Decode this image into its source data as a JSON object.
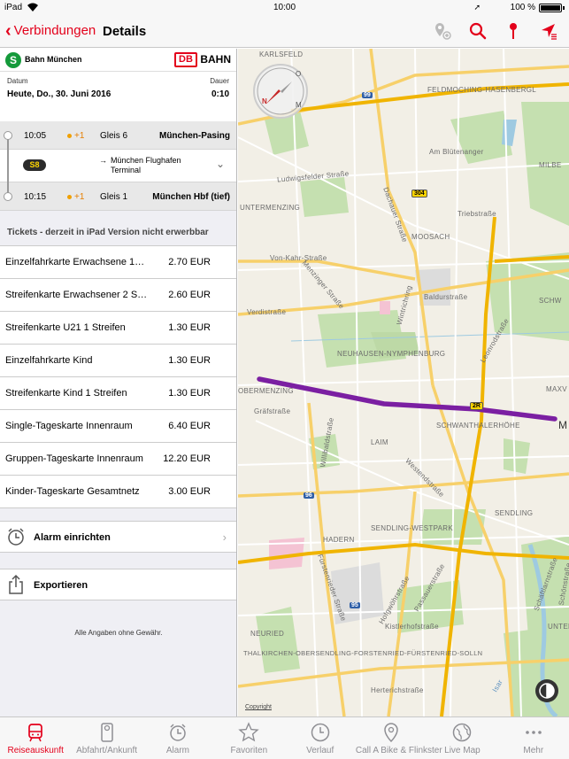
{
  "status_bar": {
    "device": "iPad",
    "time": "10:00",
    "battery": "100 %"
  },
  "nav": {
    "back_label": "Verbindungen",
    "title": "Details"
  },
  "header": {
    "operator": "Bahn München",
    "db_logo": "DB",
    "brand": "BAHN"
  },
  "date_row": {
    "date_label": "Datum",
    "date_value": "Heute, Do., 30. Juni 2016",
    "duration_label": "Dauer",
    "duration_value": "0:10"
  },
  "journey": {
    "departure": {
      "time": "10:05",
      "delay": "+1",
      "platform": "Gleis 6",
      "station": "München-Pasing"
    },
    "line": {
      "badge": "S8",
      "destination": "München Flughafen Terminal"
    },
    "arrival": {
      "time": "10:15",
      "delay": "+1",
      "platform": "Gleis 1",
      "station": "München Hbf (tief)"
    }
  },
  "tickets": {
    "heading": "Tickets - derzeit in iPad Version nicht erwerbbar",
    "items": [
      {
        "name": "Einzelfahrkarte Erwachsene 1…",
        "price": "2.70 EUR"
      },
      {
        "name": "Streifenkarte Erwachsener 2 S…",
        "price": "2.60 EUR"
      },
      {
        "name": "Streifenkarte U21 1 Streifen",
        "price": "1.30 EUR"
      },
      {
        "name": "Einzelfahrkarte Kind",
        "price": "1.30 EUR"
      },
      {
        "name": "Streifenkarte Kind 1 Streifen",
        "price": "1.30 EUR"
      },
      {
        "name": "Single-Tageskarte Innenraum",
        "price": "6.40 EUR"
      },
      {
        "name": "Gruppen-Tageskarte Innenraum",
        "price": "12.20 EUR"
      },
      {
        "name": "Kinder-Tageskarte Gesamtnetz",
        "price": "3.00 EUR"
      }
    ]
  },
  "actions": {
    "alarm": "Alarm einrichten",
    "export": "Exportieren"
  },
  "disclaimer": "Alle Angaben ohne Gewähr.",
  "map": {
    "labels": {
      "karlsfeld": "KARLSFELD",
      "feldmoching": "FELDMOCHING-HASENBERGL",
      "milbe": "MILBE",
      "am_blutenanger": "Am Blütenanger",
      "ludwigsfelder": "Ludwigsfelder Straße",
      "untermenzing": "UNTERMENZING",
      "dachauer": "Dachauer Straße",
      "triebstrasse": "Triebstraße",
      "moosach": "MOOSACH",
      "von_kahr": "Von-Kahr-Straße",
      "menzinger": "Menzinger Straße",
      "baldurstrasse": "Baldurstraße",
      "schw": "SCHW",
      "verdistrasse": "Verdistraße",
      "wintrichring": "Wintrichring",
      "leonrodstrasse": "Leonrodstraße",
      "neuhausen": "NEUHAUSEN-NYMPHENBURG",
      "obermenzing": "OBERMENZING",
      "maxv": "MAXV",
      "grafstrasse": "Gräfstraße",
      "schwanthaler": "SCHWANTHALERHÖHE",
      "willibald": "Willibaldstraße",
      "laim": "LAIM",
      "m": "M",
      "westend": "Westendstraße",
      "sendling": "SENDLING",
      "sendling_westpark": "SENDLING-WESTPARK",
      "hadern": "HADERN",
      "fuerstenrieder": "Fürstenrieder Straße",
      "passauer": "Passauerstraße",
      "hofgwoehr": "Hofgwöhrstraße",
      "kistlerhof": "Kistlerhofstraße",
      "neuried": "NEURIED",
      "untergiesing": "UNTERGIE",
      "thalkirchen": "THALKIRCHEN-OBERSENDLING-FORSTENRIED-FÜRSTENRIED-SOLLN",
      "herterich": "Herterichstraße",
      "schaeftlarn": "Schäftlarnstraße",
      "schoenstr": "Schönstraße",
      "isar": "Isar"
    },
    "shields": {
      "s99": "99",
      "s304": "304",
      "s2r": "2R",
      "s96": "96",
      "s95": "95"
    },
    "compass_letters": {
      "n": "N",
      "o": "O",
      "m": "M"
    },
    "copyright": "Copyright"
  },
  "tabs": [
    {
      "label": "Reiseauskunft",
      "icon": "train-icon"
    },
    {
      "label": "Abfahrt/Ankunft",
      "icon": "departure-board-icon"
    },
    {
      "label": "Alarm",
      "icon": "alarm-clock-icon"
    },
    {
      "label": "Favoriten",
      "icon": "star-icon"
    },
    {
      "label": "Verlauf",
      "icon": "clock-icon"
    },
    {
      "label": "Call A Bike & Flinkster",
      "icon": "location-pin-icon"
    },
    {
      "label": "Live Map",
      "icon": "globe-icon"
    },
    {
      "label": "Mehr",
      "icon": "more-dots-icon"
    }
  ],
  "colors": {
    "accent": "#e3001b",
    "route": "#7b1fa2",
    "sbahn_green": "#159a3b"
  }
}
